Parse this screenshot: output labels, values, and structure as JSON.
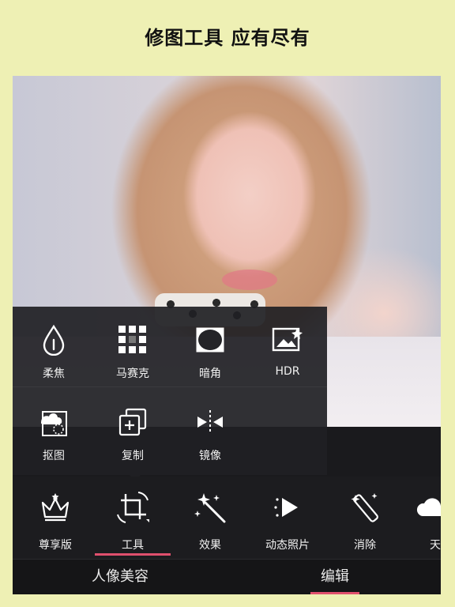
{
  "headline": "修图工具 应有尽有",
  "popup": {
    "items": [
      {
        "label": "柔焦",
        "icon": "drop-icon"
      },
      {
        "label": "马赛克",
        "icon": "mosaic-icon"
      },
      {
        "label": "暗角",
        "icon": "vignette-icon"
      },
      {
        "label": "HDR",
        "icon": "hdr-icon"
      },
      {
        "label": "抠图",
        "icon": "cutout-icon"
      },
      {
        "label": "复制",
        "icon": "duplicate-icon"
      },
      {
        "label": "镜像",
        "icon": "mirror-icon"
      }
    ]
  },
  "toolbar": {
    "items": [
      {
        "label": "尊享版",
        "icon": "crown-icon"
      },
      {
        "label": "工具",
        "icon": "crop-rotate-icon",
        "selected": true
      },
      {
        "label": "效果",
        "icon": "magic-wand-icon"
      },
      {
        "label": "动态照片",
        "icon": "play-icon"
      },
      {
        "label": "消除",
        "icon": "eraser-wand-icon"
      },
      {
        "label": "天",
        "icon": "cloud-icon"
      }
    ]
  },
  "bottom_nav": {
    "tabs": [
      {
        "label": "人像美容"
      },
      {
        "label": "编辑",
        "active": true
      }
    ]
  },
  "colors": {
    "background": "#eef0b4",
    "accent": "#e0506e",
    "panel": "#1c1c1f"
  }
}
